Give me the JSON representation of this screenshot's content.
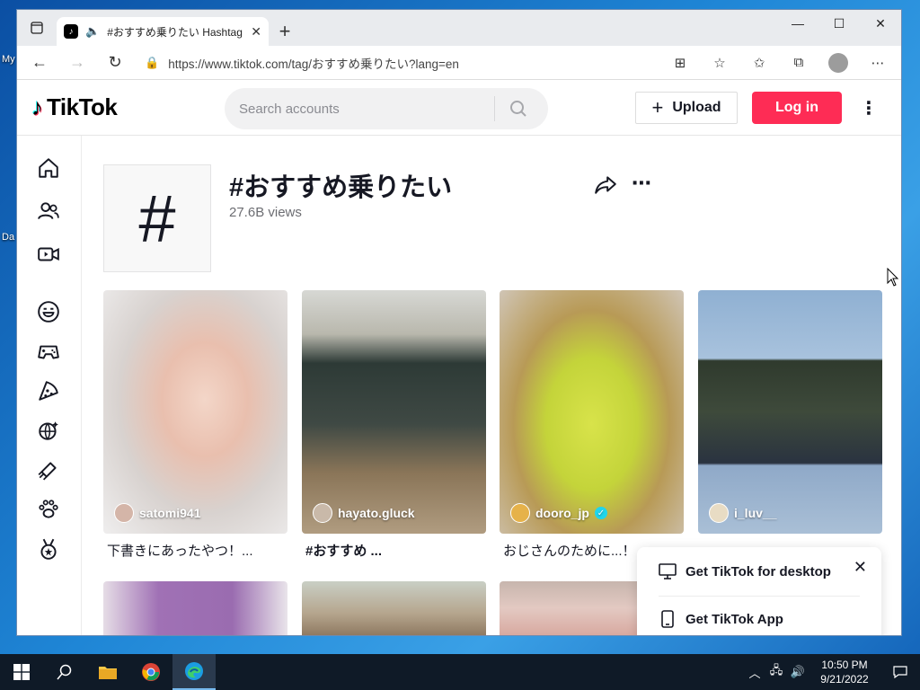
{
  "desktop": {
    "label_1": "My",
    "label_2": "Da"
  },
  "browser": {
    "tab_title": "#おすすめ乗りたい Hashtag Vi",
    "url": "https://www.tiktok.com/tag/おすすめ乗りたい?lang=en"
  },
  "tiktok": {
    "logo_text": "TikTok",
    "search_placeholder": "Search accounts",
    "upload_label": "Upload",
    "login_label": "Log in",
    "hashtag_title": "#おすすめ乗りたい",
    "views": "27.6B views",
    "videos": [
      {
        "author": "satomi941",
        "caption": "下書きにあったやつ！...",
        "verified": false
      },
      {
        "author": "hayato.gluck",
        "caption": "#おすすめ ...",
        "verified": false
      },
      {
        "author": "dooro_jp",
        "caption": "おじさんのために...！",
        "verified": true
      },
      {
        "author": "i_luv__",
        "caption": "",
        "verified": false
      }
    ],
    "popup": {
      "desktop_label": "Get TikTok for desktop",
      "app_label": "Get TikTok App"
    }
  },
  "taskbar": {
    "time": "10:50 PM",
    "date": "9/21/2022"
  },
  "colors": {
    "primary": "#fe2c55",
    "verified": "#20d5ec",
    "taskbar": "#0f1a27"
  }
}
